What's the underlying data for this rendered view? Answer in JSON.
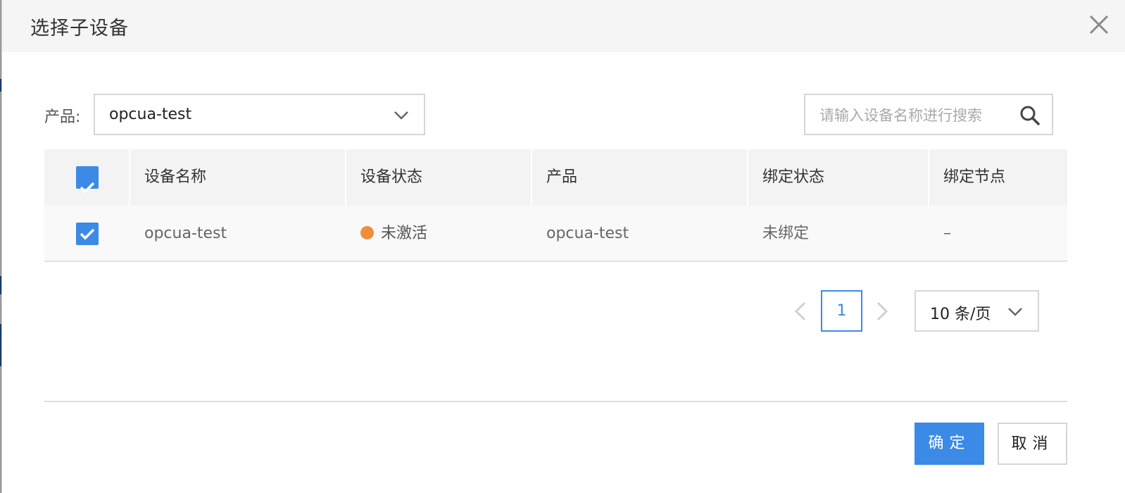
{
  "dialog": {
    "title": "选择子设备"
  },
  "filters": {
    "product_label": "产品:",
    "product_value": "opcua-test",
    "search_placeholder": "请输入设备名称进行搜索"
  },
  "table": {
    "columns": [
      "设备名称",
      "设备状态",
      "产品",
      "绑定状态",
      "绑定节点"
    ],
    "rows": [
      {
        "selected": true,
        "device_name": "opcua-test",
        "device_status": "未激活",
        "product": "opcua-test",
        "bind_status": "未绑定",
        "bind_node": "–"
      }
    ]
  },
  "pagination": {
    "current_page": "1",
    "page_size": "10 条/页"
  },
  "actions": {
    "confirm": "确定",
    "cancel": "取消"
  },
  "colors": {
    "accent": "#3b8ae6",
    "status_inactive": "#ee8f3b",
    "header_bg": "#f5f5f5"
  },
  "icons": [
    "close-icon",
    "chevron-down-icon",
    "search-icon",
    "check-icon",
    "chevron-left-icon",
    "chevron-right-icon"
  ]
}
